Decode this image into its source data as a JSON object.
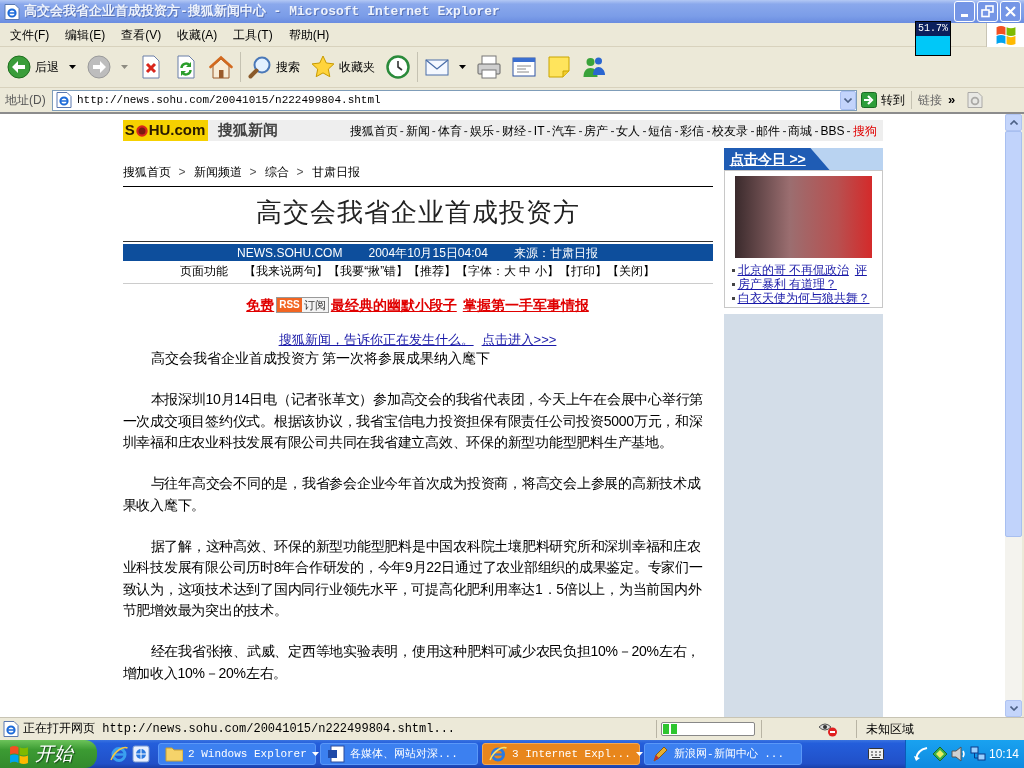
{
  "window": {
    "title": "高交会我省企业首成投资方-搜狐新闻中心 - Microsoft Internet Explorer"
  },
  "overlay": {
    "reading": "51.7%"
  },
  "menu_bar": [
    "文件(F)",
    "编辑(E)",
    "查看(V)",
    "收藏(A)",
    "工具(T)",
    "帮助(H)"
  ],
  "toolbar": {
    "groups": [
      [
        {
          "kind": "back",
          "label": "后退",
          "dropdown": true,
          "disabled": false
        },
        {
          "kind": "forward",
          "dropdown": true,
          "disabled": true
        },
        {
          "kind": "stop",
          "dropdown": false,
          "disabled": false
        },
        {
          "kind": "refresh",
          "dropdown": false,
          "disabled": false
        },
        {
          "kind": "home",
          "dropdown": false,
          "disabled": false
        }
      ],
      [
        {
          "kind": "search",
          "label": "搜索",
          "dropdown": false,
          "disabled": false
        },
        {
          "kind": "favorites",
          "label": "收藏夹",
          "dropdown": false,
          "disabled": false
        },
        {
          "kind": "history",
          "dropdown": false,
          "disabled": false
        }
      ],
      [
        {
          "kind": "mail",
          "dropdown": true,
          "disabled": false
        },
        {
          "kind": "print",
          "dropdown": false,
          "disabled": false
        },
        {
          "kind": "edit",
          "dropdown": false,
          "disabled": false
        },
        {
          "kind": "discuss",
          "dropdown": false,
          "disabled": false
        },
        {
          "kind": "messenger",
          "dropdown": false,
          "disabled": false
        }
      ]
    ]
  },
  "address_bar": {
    "label": "地址(D)",
    "value": "http://news.sohu.com/20041015/n222499804.shtml",
    "go": "转到",
    "links": "链接",
    "chevron": "»"
  },
  "page": {
    "header": {
      "logo": [
        "S",
        "HU.com"
      ],
      "section": "搜狐新闻",
      "separator": "-",
      "nav": [
        {
          "label": "搜狐首页",
          "highlighted": false
        },
        {
          "label": "新闻",
          "highlighted": false
        },
        {
          "label": "体育",
          "highlighted": false
        },
        {
          "label": "娱乐",
          "highlighted": false
        },
        {
          "label": "财经",
          "highlighted": false
        },
        {
          "label": "IT",
          "highlighted": false
        },
        {
          "label": "汽车",
          "highlighted": false
        },
        {
          "label": "房产",
          "highlighted": false
        },
        {
          "label": "女人",
          "highlighted": false
        },
        {
          "label": "短信",
          "highlighted": false
        },
        {
          "label": "彩信",
          "highlighted": false
        },
        {
          "label": "校友录",
          "highlighted": false
        },
        {
          "label": "邮件",
          "highlighted": false
        },
        {
          "label": "商城",
          "highlighted": false
        },
        {
          "label": "BBS",
          "highlighted": false
        },
        {
          "label": "搜狗",
          "highlighted": true
        }
      ]
    },
    "breadcrumb": {
      "separator": ">",
      "items": [
        "搜狐首页",
        "新闻频道",
        "综合",
        "甘肃日报"
      ]
    },
    "article": {
      "title": "高交会我省企业首成投资方",
      "meta": [
        "NEWS.SOHU.COM",
        "2004年10月15日04:04",
        "来源：甘肃日报"
      ],
      "tools_label": "页面功能",
      "tools": [
        "【我来说两句】",
        "【我要“揪”错】",
        "【推荐】",
        "【字体：大 中 小】",
        "【打印】",
        "【关闭】"
      ],
      "promo": [
        {
          "kind": "link",
          "label": "免费"
        },
        {
          "kind": "badge",
          "mark": "RSS",
          "caption": "订阅"
        },
        {
          "kind": "link",
          "label": "最经典的幽默小段子"
        },
        {
          "kind": "link",
          "label": "掌握第一手军事情报"
        }
      ],
      "tagline": [
        "搜狐新闻，告诉你正在发生什么。",
        "点击进入>>>"
      ],
      "subtitle": "高交会我省企业首成投资方 第一次将参展成果纳入麾下",
      "paragraphs": [
        "本报深圳10月14日电（记者张革文）参加高交会的我省代表团，今天上午在会展中心举行第一次成交项目签约仪式。根据该协议，我省宝信电力投资担保有限责任公司投资5000万元，和深圳幸福和庄农业科技发展有限公司共同在我省建立高效、环保的新型功能型肥料生产基地。",
        "与往年高交会不同的是，我省参会企业今年首次成为投资商，将高交会上参展的高新技术成果收入麾下。",
        "据了解，这种高效、环保的新型功能型肥料是中国农科院土壤肥料研究所和深圳幸福和庄农业科技发展有限公司历时8年合作研发的，今年9月22日通过了农业部组织的成果鉴定。专家们一致认为，这项技术达到了国内同行业领先水平，可提高化肥利用率达1．5倍以上，为当前国内外节肥增效最为突出的技术。",
        "经在我省张掖、武威、定西等地实验表明，使用这种肥料可减少农民负担10%－20%左右，增加收入10%－20%左右。"
      ]
    },
    "sidebar": {
      "header": "点击今日 >>",
      "links": [
        {
          "label": "北京的哥 不再侃政治",
          "comment": "评"
        },
        {
          "label": "房产暴利 有道理？"
        },
        {
          "label": "白衣天使为何与狼共舞？"
        }
      ]
    }
  },
  "status_bar": {
    "text": "正在打开网页 http://news.sohu.com/20041015/n222499804.shtml...",
    "level": 0.16,
    "zone": "未知区域"
  },
  "taskbar": {
    "start": "开始",
    "tasks": [
      {
        "kind": "folder",
        "label": "2 Windows Explorer",
        "grouped": true,
        "flashing": false
      },
      {
        "kind": "document",
        "label": "各媒体、网站对深...",
        "grouped": false,
        "flashing": false
      },
      {
        "kind": "browser",
        "label": "3 Internet Expl...",
        "grouped": true,
        "flashing": true
      },
      {
        "kind": "pencil",
        "label": "新浪网-新闻中心 ...",
        "grouped": false,
        "flashing": false
      }
    ],
    "clock": "10:14"
  }
}
